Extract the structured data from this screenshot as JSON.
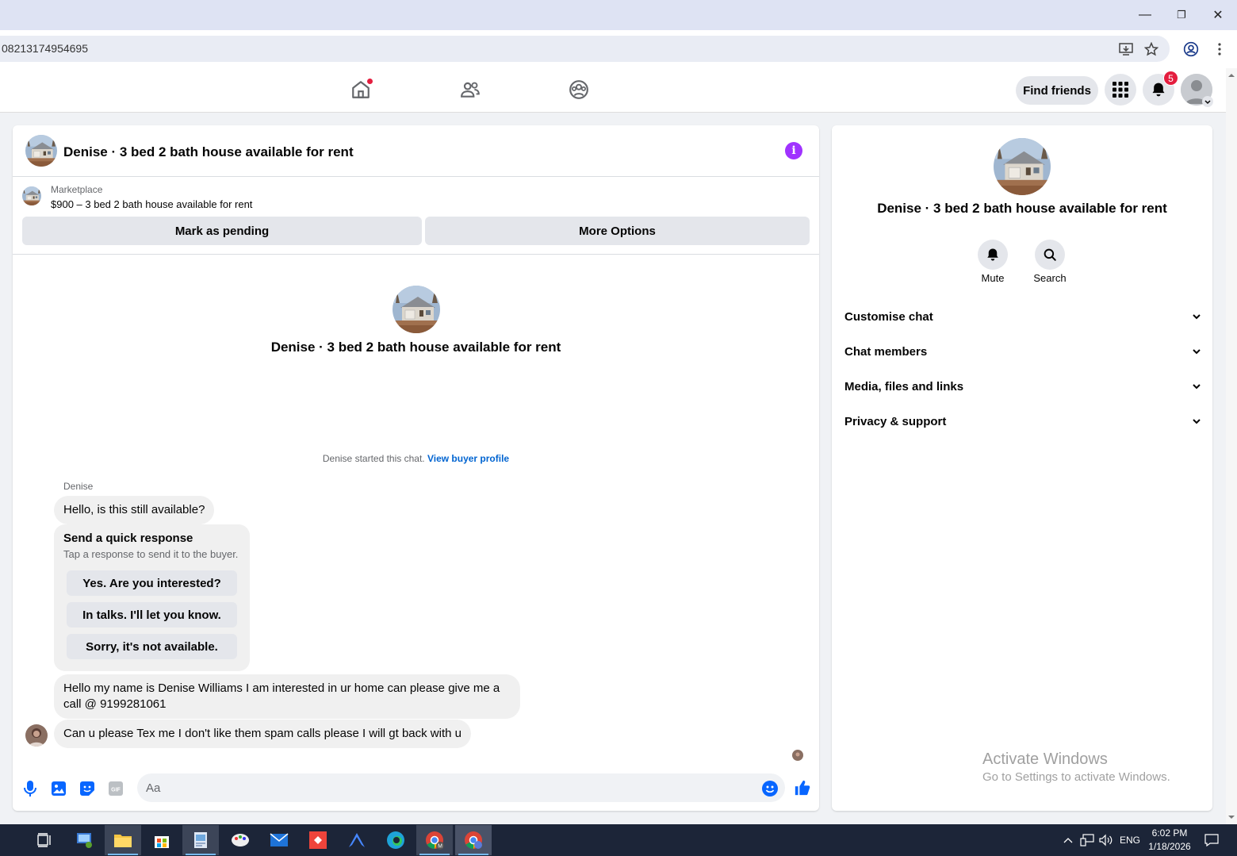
{
  "browser": {
    "url": "08213174954695",
    "window_controls": {
      "minimize": "—",
      "restore": "❐",
      "close": "✕"
    }
  },
  "fb_nav": {
    "find_friends": "Find friends",
    "notification_count": "5"
  },
  "chat_header": {
    "title": "Denise · 3 bed 2 bath house available for rent",
    "marketplace_label": "Marketplace",
    "listing": "$900 – 3 bed 2 bath house available for rent",
    "mark_pending": "Mark as pending",
    "more_options": "More Options"
  },
  "chat_intro": {
    "name": "Denise · 3 bed 2 bath house available for rent",
    "started_text": "Denise started this chat.",
    "view_buyer_profile": "View buyer profile"
  },
  "messages": {
    "sender": "Denise",
    "msg1": "Hello, is this still available?",
    "quick_response_title": "Send a quick response",
    "quick_response_sub": "Tap a response to send it to the buyer.",
    "quick_responses": [
      "Yes. Are you interested?",
      "In talks. I'll let you know.",
      "Sorry, it's not available."
    ],
    "msg2": "Hello my name is Denise Williams I am interested in ur home can please give me a call @ 9199281061",
    "msg3": "Can u please Tex me I don't like them spam calls please I will gt back with u"
  },
  "composer": {
    "placeholder": "Aa"
  },
  "sidebar": {
    "title": "Denise · 3 bed 2 bath house available for rent",
    "mute": "Mute",
    "search": "Search",
    "sections": [
      "Customise chat",
      "Chat members",
      "Media, files and links",
      "Privacy & support"
    ]
  },
  "watermark": {
    "line1": "Activate Windows",
    "line2": "Go to Settings to activate Windows."
  },
  "taskbar": {
    "lang": "ENG",
    "time": "6:02 PM",
    "date": "1/18/2026"
  },
  "colors": {
    "accent_purple": "#a033ff",
    "link_blue": "#0064d1",
    "like_blue": "#0866ff",
    "badge_red": "#e41e3f"
  }
}
